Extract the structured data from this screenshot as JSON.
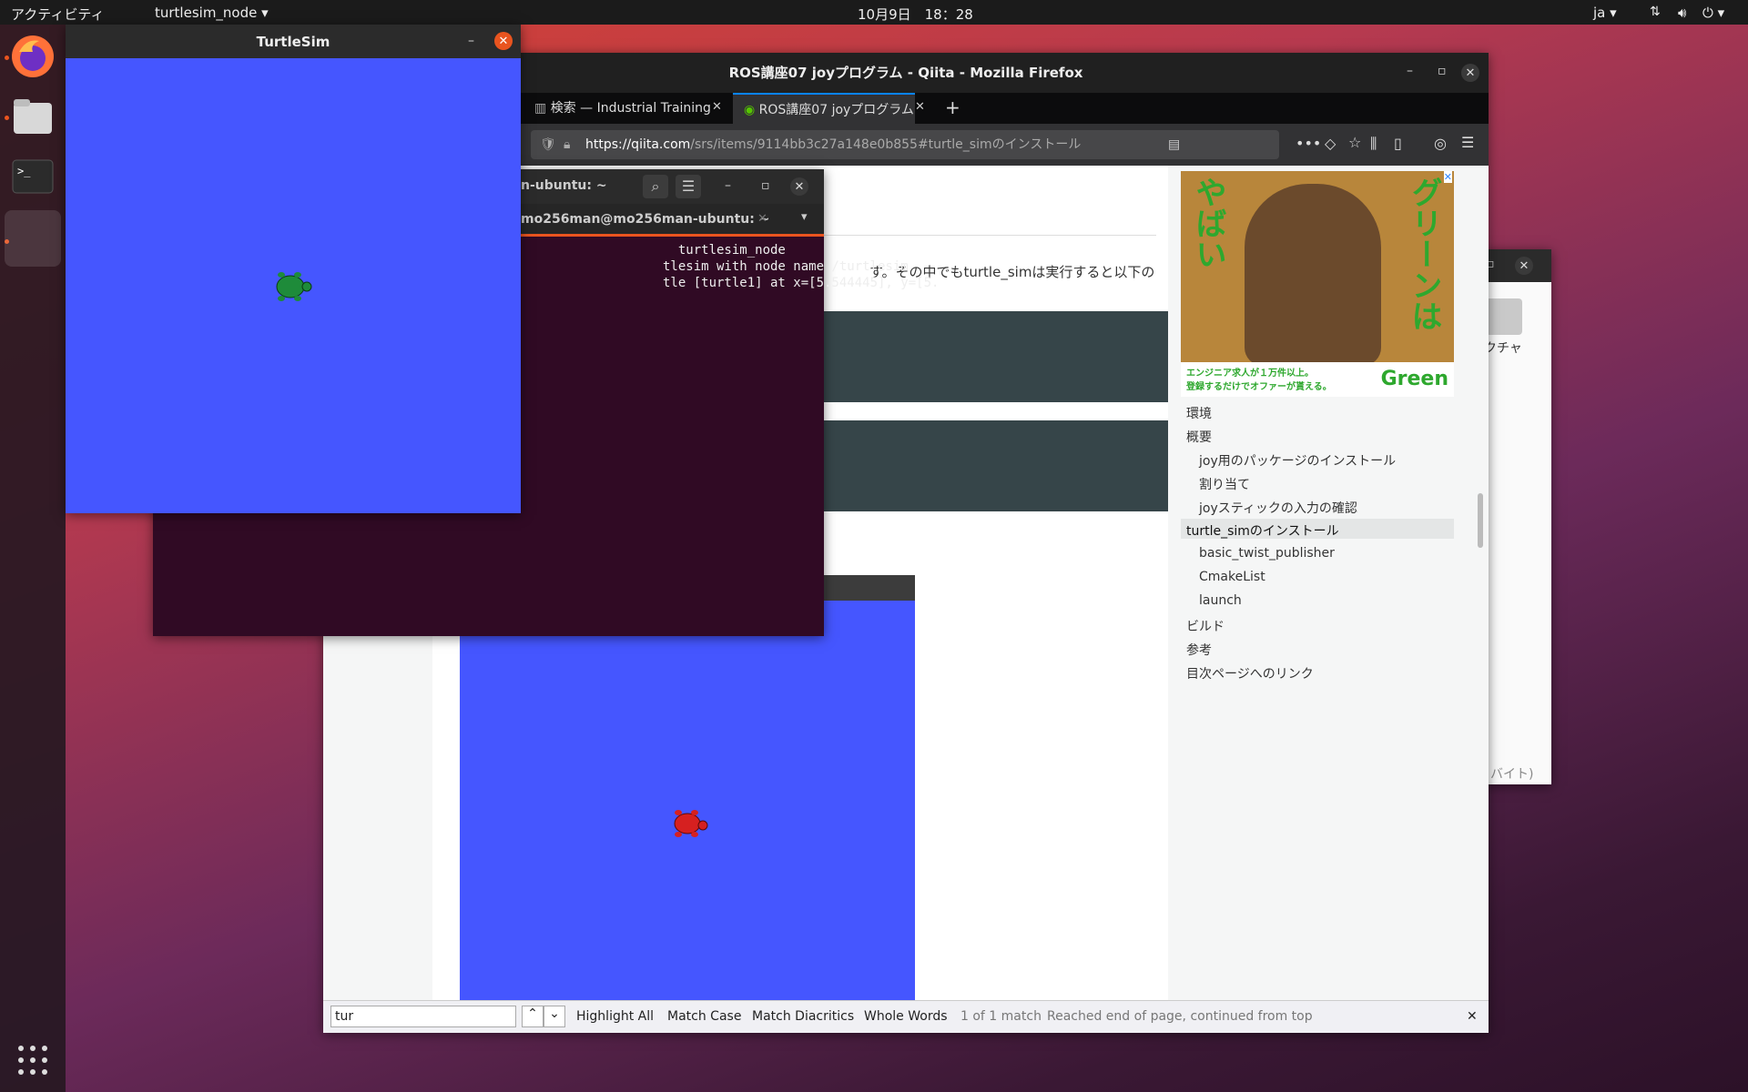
{
  "topbar": {
    "activities": "アクティビティ",
    "app_menu": "turtlesim_node",
    "clock": "10月9日　18：28",
    "lang": "ja"
  },
  "firefox": {
    "title": "ROS講座07 joyプログラム - Qiita - Mozilla Firefox",
    "tabs": [
      {
        "label": "検索 — Industrial Training"
      },
      {
        "label": "ROS講座07 joyプログラム"
      }
    ],
    "url_host": "https://qiita.com",
    "url_path": "/srs/items/9114bb3c27a148e0b855#turtle_simのインストール",
    "article_snippet": "す。その中でもturtle_simは実行すると以下の",
    "ad": {
      "headline": "グリーンは",
      "side_text": "やばい",
      "sub1": "エンジニア求人が１万件以上。",
      "sub2": "登録するだけでオファーが貰える。",
      "brand": "Green"
    },
    "toc": [
      {
        "label": "環境",
        "indent": false,
        "active": false
      },
      {
        "label": "概要",
        "indent": false,
        "active": false
      },
      {
        "label": "joy用のパッケージのインストール",
        "indent": true,
        "active": false
      },
      {
        "label": "割り当て",
        "indent": true,
        "active": false
      },
      {
        "label": "joyスティックの入力の確認",
        "indent": true,
        "active": false
      },
      {
        "label": "turtle_simのインストール",
        "indent": false,
        "active": true
      },
      {
        "label": "basic_twist_publisher",
        "indent": true,
        "active": false
      },
      {
        "label": "CmakeList",
        "indent": true,
        "active": false
      },
      {
        "label": "launch",
        "indent": true,
        "active": false
      },
      {
        "label": "ビルド",
        "indent": false,
        "active": false
      },
      {
        "label": "参考",
        "indent": false,
        "active": false
      },
      {
        "label": "目次ページへのリンク",
        "indent": false,
        "active": false
      }
    ],
    "findbar": {
      "query": "tur",
      "highlight_all": "Highlight All",
      "match_case": "Match Case",
      "match_diacritics": "Match Diacritics",
      "whole_words": "Whole Words",
      "status": "1 of 1 match",
      "message": "Reached end of page, continued from top"
    }
  },
  "turtlesim": {
    "title": "TurtleSim",
    "bg_color": "#4556ff"
  },
  "terminal": {
    "title": "n-ubuntu: ~",
    "tab_title": "mo256man@mo256man-ubuntu: ~",
    "lines": [
      "  turtlesim_node",
      "tlesim with node name /turtlesim",
      "tle [turtle1] at x=[5.544445], y=[5."
    ]
  },
  "files_window": {
    "label": "クチャ",
    "status": "ﾞバイト)"
  },
  "colors": {
    "accent": "#e9541f",
    "terminal_bg": "#300a24",
    "turtle_green": "#1e8b3a",
    "turtle_red": "#d62020"
  }
}
